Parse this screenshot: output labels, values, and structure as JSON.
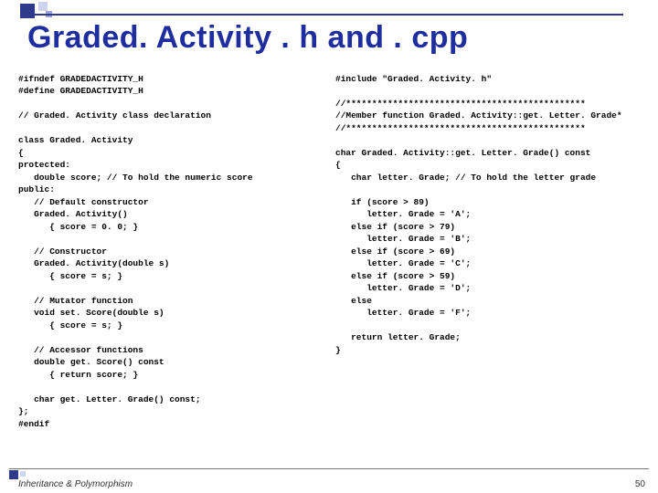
{
  "title": "Graded. Activity . h and . cpp",
  "left_code": "#ifndef GRADEDACTIVITY_H\n#define GRADEDACTIVITY_H\n\n// Graded. Activity class declaration\n\nclass Graded. Activity\n{\nprotected:\n   double score; // To hold the numeric score\npublic:\n   // Default constructor\n   Graded. Activity()\n      { score = 0. 0; }\n\n   // Constructor\n   Graded. Activity(double s)\n      { score = s; }\n\n   // Mutator function\n   void set. Score(double s)\n      { score = s; }\n\n   // Accessor functions\n   double get. Score() const\n      { return score; }\n\n   char get. Letter. Grade() const;\n};\n#endif",
  "right_code": "#include \"Graded. Activity. h\"\n\n//**********************************************\n//Member function Graded. Activity::get. Letter. Grade*\n//**********************************************\n\nchar Graded. Activity::get. Letter. Grade() const\n{\n   char letter. Grade; // To hold the letter grade\n\n   if (score > 89)\n      letter. Grade = 'A';\n   else if (score > 79)\n      letter. Grade = 'B';\n   else if (score > 69)\n      letter. Grade = 'C';\n   else if (score > 59)\n      letter. Grade = 'D';\n   else\n      letter. Grade = 'F';\n\n   return letter. Grade;\n}",
  "footer_left": "Inheritance & Polymorphism",
  "footer_right": "50"
}
